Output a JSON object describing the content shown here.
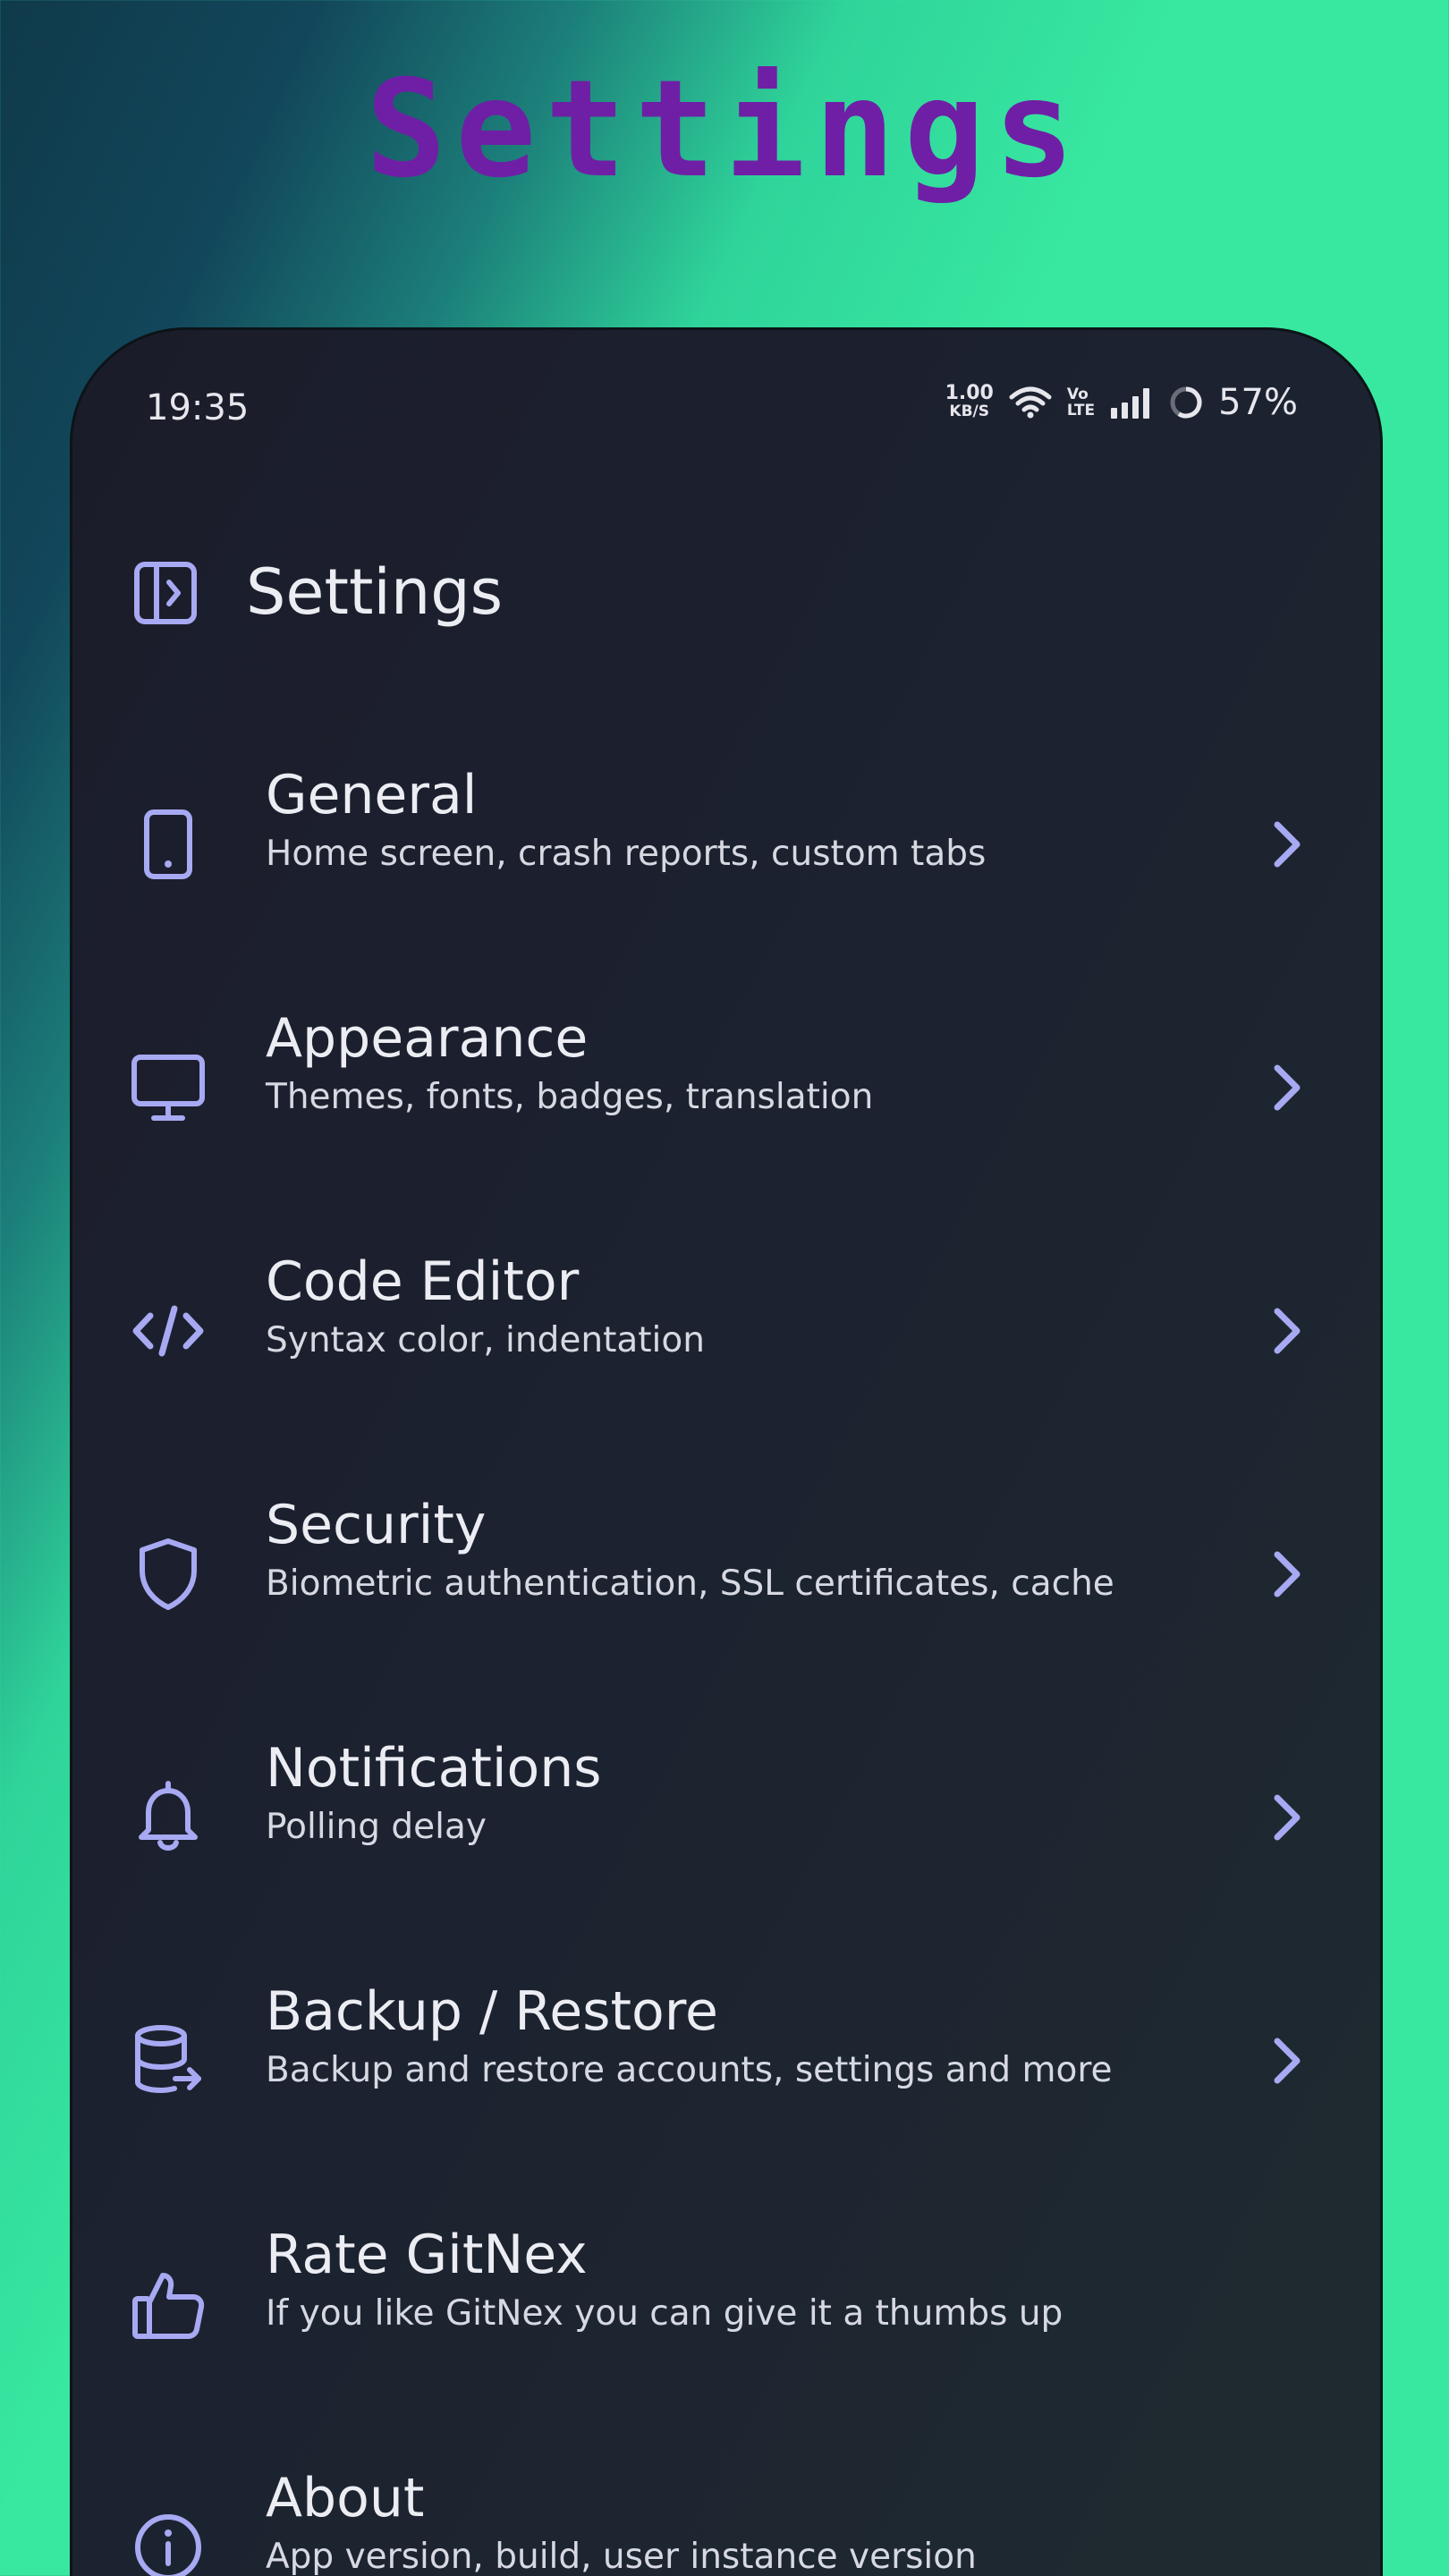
{
  "promo": {
    "title": "Settings"
  },
  "status_bar": {
    "time": "19:35",
    "net_speed_value": "1.00",
    "net_speed_unit": "KB/S",
    "volte_top": "Vo",
    "volte_bottom": "LTE",
    "battery": "57%"
  },
  "app_bar": {
    "title": "Settings",
    "drawer_icon": "sidebar-expand-icon"
  },
  "settings_items": [
    {
      "title": "General",
      "subtitle": "Home screen, crash reports, custom tabs",
      "icon": "smartphone-icon",
      "has_chevron": true
    },
    {
      "title": "Appearance",
      "subtitle": "Themes, fonts, badges, translation",
      "icon": "monitor-icon",
      "has_chevron": true
    },
    {
      "title": "Code Editor",
      "subtitle": "Syntax color, indentation",
      "icon": "code-icon",
      "has_chevron": true
    },
    {
      "title": "Security",
      "subtitle": "Biometric authentication, SSL certificates, cache",
      "icon": "shield-icon",
      "has_chevron": true
    },
    {
      "title": "Notifications",
      "subtitle": "Polling delay",
      "icon": "bell-icon",
      "has_chevron": true
    },
    {
      "title": "Backup / Restore",
      "subtitle": "Backup and restore accounts, settings and more",
      "icon": "database-export-icon",
      "has_chevron": true
    },
    {
      "title": "Rate GitNex",
      "subtitle": "If you like GitNex you can give it a thumbs up",
      "icon": "thumbs-up-icon",
      "has_chevron": false
    },
    {
      "title": "About",
      "subtitle": "App version, build, user instance version",
      "icon": "info-icon",
      "has_chevron": false
    }
  ],
  "colors": {
    "accent": "#a7a9f2",
    "promo_title": "#6f1fa5",
    "background_green": "#38e8a0",
    "surface": "#1c2230"
  }
}
